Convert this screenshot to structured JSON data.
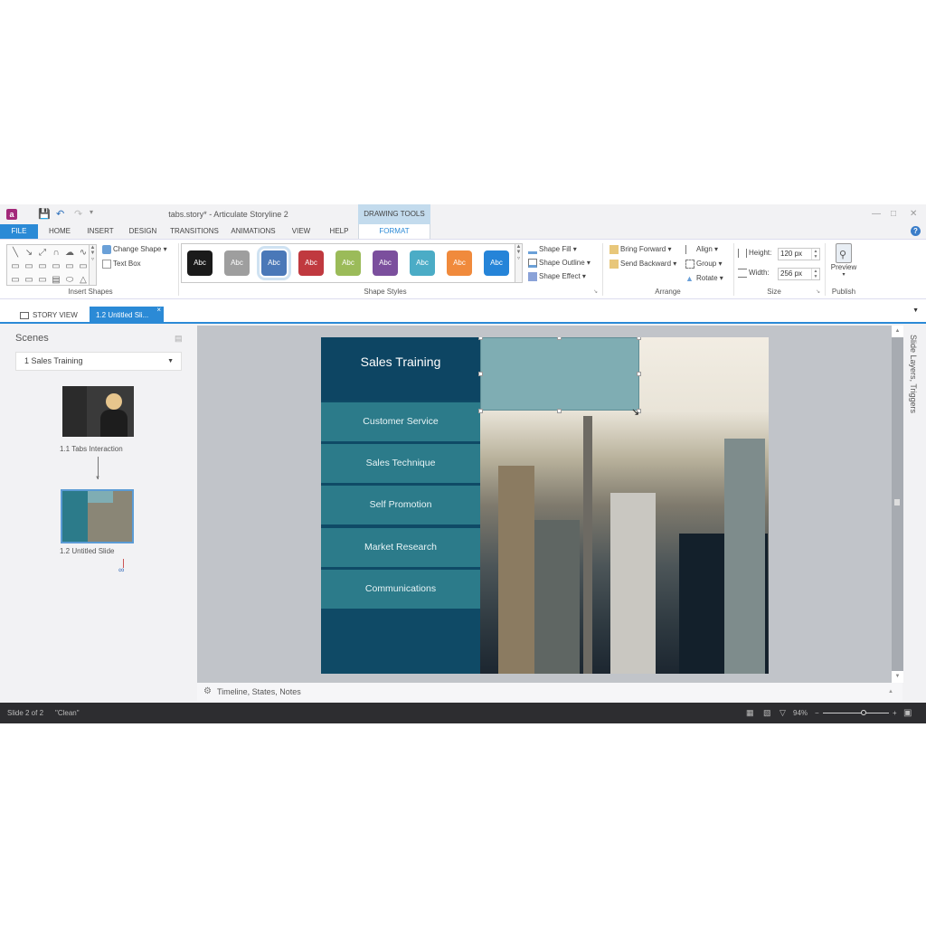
{
  "titlebar": {
    "app_icon": "storyline-app-icon",
    "title": "tabs.story* - Articulate Storyline 2",
    "contextual_group": "DRAWING TOOLS",
    "quick_access": [
      "save-icon",
      "undo-icon",
      "redo-icon",
      "customize-icon"
    ]
  },
  "tabs": [
    {
      "label": "FILE"
    },
    {
      "label": "HOME"
    },
    {
      "label": "INSERT"
    },
    {
      "label": "DESIGN"
    },
    {
      "label": "TRANSITIONS"
    },
    {
      "label": "ANIMATIONS"
    },
    {
      "label": "VIEW"
    },
    {
      "label": "HELP"
    },
    {
      "label": "FORMAT"
    }
  ],
  "ribbon": {
    "insert_shapes": {
      "label": "Insert Shapes",
      "change_shape": "Change Shape",
      "text_box": "Text Box"
    },
    "shape_styles": {
      "label": "Shape Styles",
      "swatch_text": "Abc",
      "swatches": [
        "#1a1a1a",
        "#9e9e9e",
        "#4a78b8",
        "#c0393f",
        "#9bbb59",
        "#7b4f9d",
        "#4bacc6",
        "#f08a3c",
        "#2584d8"
      ],
      "selected_index": 2,
      "shape_fill": "Shape Fill",
      "shape_outline": "Shape Outline",
      "shape_effect": "Shape Effect"
    },
    "arrange": {
      "label": "Arrange",
      "bring_forward": "Bring Forward",
      "send_backward": "Send Backward",
      "align": "Align",
      "group": "Group",
      "rotate": "Rotate"
    },
    "size": {
      "label": "Size",
      "height_label": "Height:",
      "height_value": "120 px",
      "width_label": "Width:",
      "width_value": "256 px"
    },
    "publish": {
      "label": "Publish",
      "preview": "Preview"
    }
  },
  "doctabs": {
    "story_view": "STORY VIEW",
    "active": "1.2 Untitled Sli..."
  },
  "scenes": {
    "title": "Scenes",
    "selected": "1 Sales Training",
    "slides": [
      {
        "label": "1.1 Tabs Interaction"
      },
      {
        "label": "1.2 Untitled Slide"
      }
    ]
  },
  "slide": {
    "title": "Sales Training",
    "menu": [
      "Customer Service",
      "Sales Technique",
      "Self Promotion",
      "Market Research",
      "Communications"
    ]
  },
  "panels": {
    "layers_triggers": "Slide Layers, Triggers",
    "timeline": "Timeline, States, Notes"
  },
  "status": {
    "slide": "Slide 2 of 2",
    "theme": "\"Clean\"",
    "zoom": "94%",
    "zoom_fraction": 0.62
  }
}
